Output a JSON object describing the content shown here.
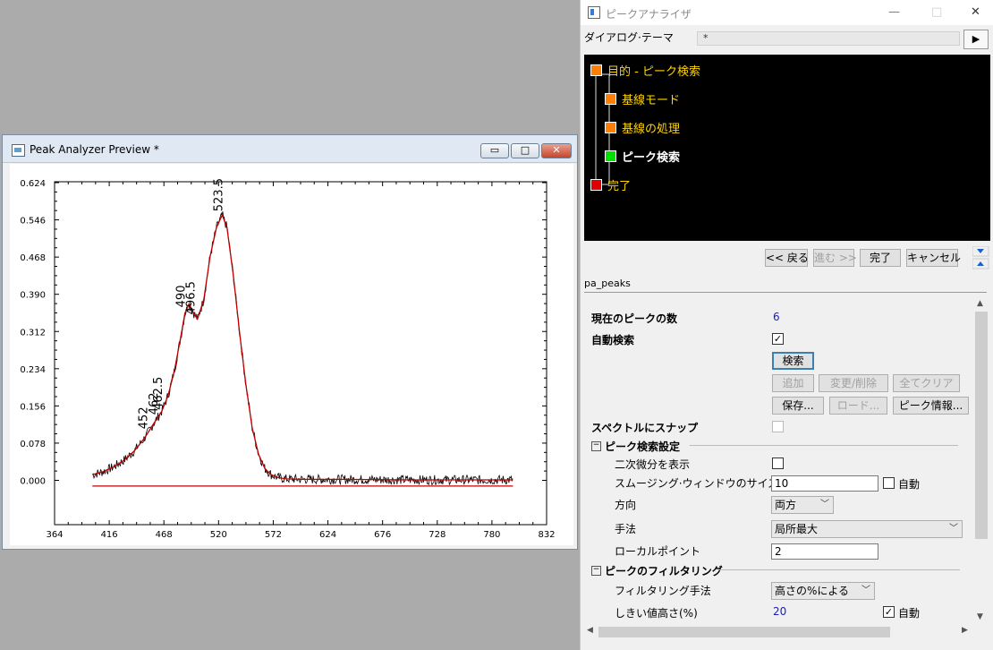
{
  "preview": {
    "title": "Peak Analyzer Preview *",
    "buttons": {
      "minimize": "▭",
      "maximize": "□",
      "close": "✕"
    }
  },
  "chart_data": {
    "type": "line",
    "x_ticks": [
      "364",
      "416",
      "468",
      "520",
      "572",
      "624",
      "676",
      "728",
      "780",
      "832"
    ],
    "y_ticks": [
      "0.624",
      "0.546",
      "0.468",
      "0.390",
      "0.312",
      "0.234",
      "0.156",
      "0.078",
      "0.000"
    ],
    "xlim": [
      364,
      832
    ],
    "ylim": [
      -0.05,
      0.624
    ],
    "series": [
      {
        "color": "#c00000",
        "x": [
          400,
          410,
          420,
          430,
          440,
          450,
          458,
          466,
          472,
          478,
          484,
          488,
          492,
          496,
          500,
          506,
          512,
          518,
          523.5,
          528,
          534,
          540,
          546,
          552,
          558,
          564,
          570,
          576,
          584,
          600,
          640,
          700,
          760,
          800
        ],
        "y": [
          0.012,
          0.018,
          0.028,
          0.042,
          0.062,
          0.09,
          0.118,
          0.145,
          0.178,
          0.23,
          0.3,
          0.35,
          0.37,
          0.352,
          0.338,
          0.38,
          0.47,
          0.53,
          0.556,
          0.53,
          0.43,
          0.31,
          0.2,
          0.11,
          0.055,
          0.025,
          0.012,
          0.006,
          0.003,
          0.002,
          0.002,
          0.001,
          0.001,
          0.001
        ]
      },
      {
        "color": "#c00000",
        "x": [
          400,
          800
        ],
        "y": [
          -0.012,
          -0.012
        ]
      }
    ],
    "peak_labels": [
      {
        "text": "452",
        "x": 452,
        "y": 0.1
      },
      {
        "text": "462",
        "x": 462,
        "y": 0.13
      },
      {
        "text": "462.5",
        "x": 466,
        "y": 0.14
      },
      {
        "text": "490",
        "x": 488,
        "y": 0.355
      },
      {
        "text": "496.5",
        "x": 497,
        "y": 0.34
      },
      {
        "text": "523.5",
        "x": 523.5,
        "y": 0.556
      }
    ]
  },
  "analyzer": {
    "title": "ピークアナライザ",
    "controls": {
      "minimize": "—",
      "maximize": "□",
      "close": "✕"
    },
    "theme_label": "ダイアログ·テーマ",
    "theme_value": "*",
    "theme_button": "▶",
    "steps": [
      {
        "label": "目的 - ピーク検索",
        "color": "#ff7f00"
      },
      {
        "label": "基線モード",
        "color": "#ff7f00"
      },
      {
        "label": "基線の処理",
        "color": "#ff7f00"
      },
      {
        "label": "ピーク検索",
        "color": "#00e000"
      },
      {
        "label": "完了",
        "color": "#e00000"
      }
    ],
    "nav": {
      "back": "<< 戻る",
      "next": "進む >>",
      "finish": "完了",
      "cancel": "キャンセル"
    },
    "panel_name": "pa_peaks",
    "fields": {
      "peak_count_label": "現在のピークの数",
      "peak_count_value": "6",
      "auto_find_label": "自動検索",
      "find_button": "検索",
      "add_button": "追加",
      "modify_button": "変更/削除",
      "clear_button": "全てクリア",
      "save_button": "保存...",
      "load_button": "ロード...",
      "info_button": "ピーク情報...",
      "snap_label": "スペクトルにスナップ",
      "section_find": "ピーク検索設定",
      "second_deriv_label": "二次微分を表示",
      "smooth_label": "スムージング·ウィンドウのサイズ",
      "smooth_value": "10",
      "smooth_auto": "自動",
      "direction_label": "方向",
      "direction_value": "両方",
      "method_label": "手法",
      "method_value": "局所最大",
      "local_points_label": "ローカルポイント",
      "local_points_value": "2",
      "section_filter": "ピークのフィルタリング",
      "filter_method_label": "フィルタリング手法",
      "filter_method_value": "高さの%による",
      "threshold_label": "しきい値高さ(%)",
      "threshold_value": "20",
      "threshold_auto": "自動"
    }
  }
}
